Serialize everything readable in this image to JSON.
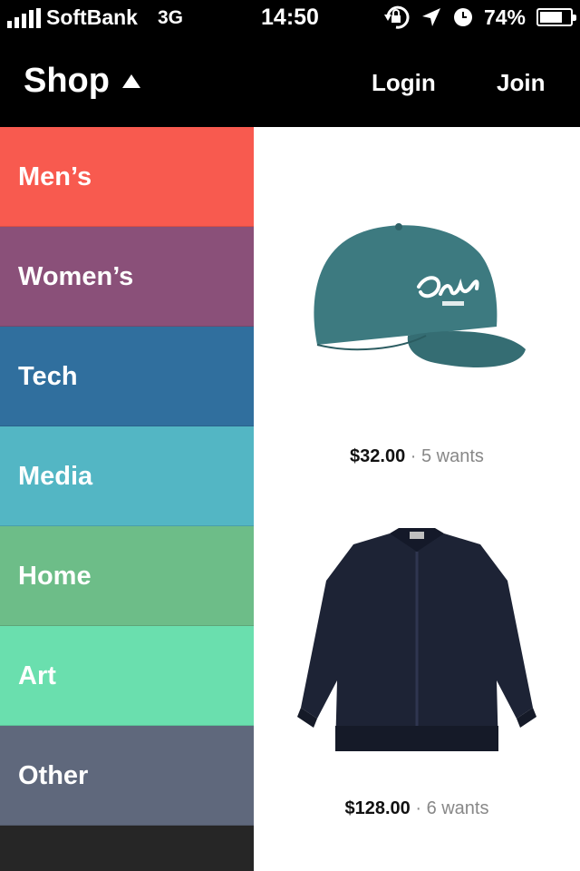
{
  "status_bar": {
    "carrier": "SoftBank",
    "network": "3G",
    "time": "14:50",
    "battery": "74%",
    "battery_level": 0.74
  },
  "nav": {
    "title": "Shop",
    "login": "Login",
    "join": "Join"
  },
  "categories": [
    {
      "label": "Men’s",
      "color": "#f85a4f"
    },
    {
      "label": "Women’s",
      "color": "#8a5079"
    },
    {
      "label": "Tech",
      "color": "#306f9e"
    },
    {
      "label": "Media",
      "color": "#53b6c4"
    },
    {
      "label": "Home",
      "color": "#6dbd88"
    },
    {
      "label": "Art",
      "color": "#6adfae"
    },
    {
      "label": "Other",
      "color": "#5f687c"
    }
  ],
  "products": [
    {
      "price": "$32.00",
      "wants": "5 wants",
      "icon": "cap-icon",
      "color": "#3d7a80"
    },
    {
      "price": "$128.00",
      "wants": "6 wants",
      "icon": "jacket-icon",
      "color": "#1d2335"
    }
  ]
}
